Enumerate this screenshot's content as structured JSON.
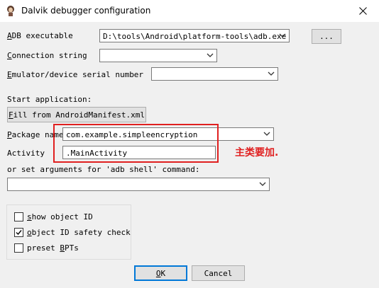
{
  "window": {
    "title": "Dalvik debugger configuration",
    "icon": "app-icon"
  },
  "fields": {
    "adb_executable": {
      "label_u": "A",
      "label_rest": "DB executable",
      "value": "D:\\tools\\Android\\platform-tools\\adb.exe"
    },
    "browse_label": "...",
    "connection_string": {
      "label_u": "C",
      "label_rest": "onnection string",
      "value": ""
    },
    "emulator_serial": {
      "label_u": "E",
      "label_rest": "mulator/device serial number",
      "value": ""
    },
    "start_application": "Start application:",
    "fill_button": {
      "label_u": "F",
      "label_rest": "ill from AndroidManifest.xml"
    },
    "package_name": {
      "label_u": "P",
      "label_rest": "ackage name",
      "value": "com.example.simpleencryption"
    },
    "activity": {
      "label": "Activity",
      "value": ".MainActivity"
    },
    "set_args_label": "or set arguments for 'adb shell' command:",
    "set_args_value": ""
  },
  "options": [
    {
      "pre": "",
      "u": "s",
      "rest": "how object ID",
      "checked": false
    },
    {
      "pre": "",
      "u": "o",
      "rest": "bject ID safety check",
      "checked": true
    },
    {
      "pre": "preset ",
      "u": "B",
      "rest": "PTs",
      "checked": false
    }
  ],
  "buttons": {
    "ok": {
      "u": "O",
      "rest": "K"
    },
    "cancel": "Cancel"
  },
  "annotation": {
    "text": "主类要加.",
    "color": "#e02020"
  }
}
